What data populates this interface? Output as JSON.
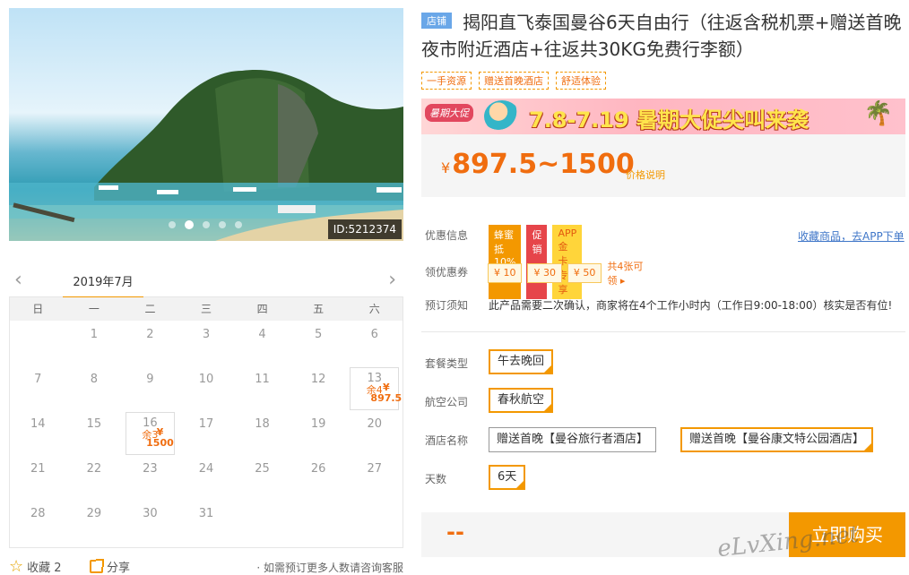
{
  "photo": {
    "id_label": "ID:5212374",
    "slides": 5,
    "active_slide": 2
  },
  "calendar": {
    "month_label": "2019年7月",
    "prev_icon": "chevron-left-icon",
    "next_icon": "chevron-right-icon",
    "weekdays": [
      "日",
      "一",
      "二",
      "三",
      "四",
      "五",
      "六"
    ],
    "days": [
      {
        "n": ""
      },
      {
        "n": "1"
      },
      {
        "n": "2"
      },
      {
        "n": "3"
      },
      {
        "n": "4"
      },
      {
        "n": "5"
      },
      {
        "n": "6"
      },
      {
        "n": "7"
      },
      {
        "n": "8"
      },
      {
        "n": "9"
      },
      {
        "n": "10"
      },
      {
        "n": "11"
      },
      {
        "n": "12"
      },
      {
        "n": "13",
        "price": "¥ 897.5",
        "stock": "余4"
      },
      {
        "n": "14"
      },
      {
        "n": "15"
      },
      {
        "n": "16",
        "price": "¥ 1500",
        "stock": "余3"
      },
      {
        "n": "17"
      },
      {
        "n": "18"
      },
      {
        "n": "19"
      },
      {
        "n": "20"
      },
      {
        "n": "21"
      },
      {
        "n": "22"
      },
      {
        "n": "23"
      },
      {
        "n": "24"
      },
      {
        "n": "25"
      },
      {
        "n": "26"
      },
      {
        "n": "27"
      },
      {
        "n": "28"
      },
      {
        "n": "29"
      },
      {
        "n": "30"
      },
      {
        "n": "31"
      },
      {
        "n": ""
      },
      {
        "n": ""
      },
      {
        "n": ""
      }
    ]
  },
  "footer": {
    "fav_label": "收藏 2",
    "share_label": "分享",
    "tip": "· 如需预订更多人数请咨询客服"
  },
  "product": {
    "store_badge": "店铺",
    "title": "揭阳直飞泰国曼谷6天自由行（往返含税机票+赠送首晚夜市附近酒店+往返共30KG免费行李额）",
    "tags": [
      "一手资源",
      "赠送首晚酒店",
      "舒适体验"
    ],
    "banner": {
      "left": "暑期大促",
      "text": "7.8-7.19 暑期大促尖叫来袭"
    },
    "price_yen": "¥",
    "price_range": "897.5~1500",
    "price_note": "价格说明"
  },
  "promo": {
    "label": "优惠信息",
    "pills": [
      "蜂蜜抵10%",
      "促销",
      "APP金卡专享"
    ],
    "fav_app": "收藏商品，去APP下单"
  },
  "coupon": {
    "label": "领优惠券",
    "items": [
      "¥ 10",
      "¥ 30",
      "¥ 50"
    ],
    "more": "共4张可领 ▸"
  },
  "notice": {
    "label": "预订须知",
    "text": "此产品需要二次确认，商家将在4个工作小时内（工作日9:00-18:00）核实是否有位!"
  },
  "options": {
    "package": {
      "label": "套餐类型",
      "values": [
        "午去晚回"
      ]
    },
    "airline": {
      "label": "航空公司",
      "values": [
        "春秋航空"
      ]
    },
    "hotel": {
      "label": "酒店名称",
      "values": [
        "赠送首晚【曼谷旅行者酒店】",
        "赠送首晚【曼谷康文特公园酒店】"
      ]
    },
    "days": {
      "label": "天数",
      "values": [
        "6天"
      ]
    }
  },
  "buy": {
    "total": "--",
    "button": "立即购买"
  },
  "watermark": "eLvXing.net"
}
